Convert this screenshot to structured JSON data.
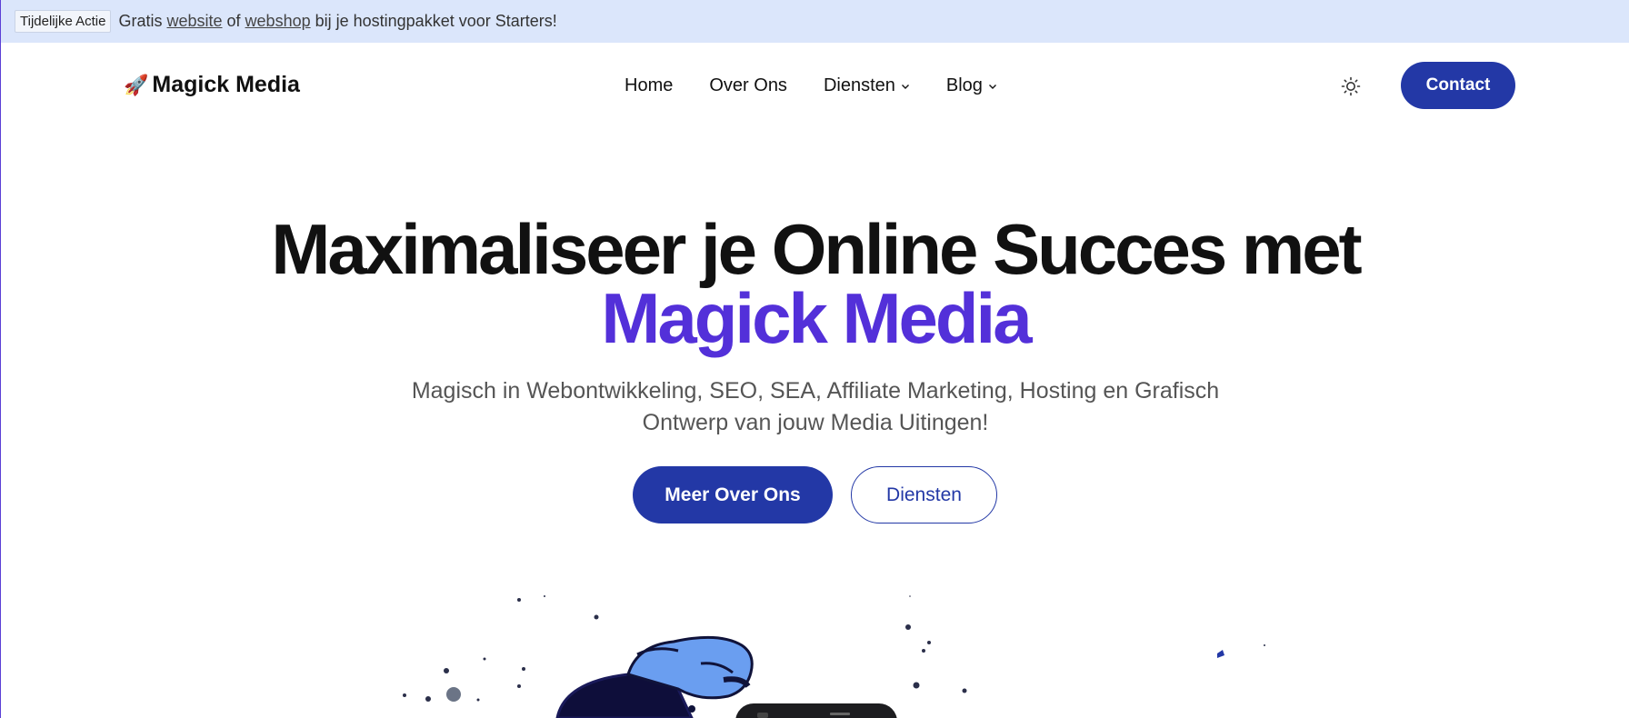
{
  "promo": {
    "badge": "Tijdelijke Actie",
    "text_before": "Gratis",
    "link_website": "website",
    "text_mid": "of",
    "link_webshop": "webshop",
    "text_after": "bij je hostingpakket voor Starters!"
  },
  "header": {
    "logo_icon": "rocket-icon",
    "logo_text": "Magick Media",
    "nav": {
      "home": "Home",
      "over_ons": "Over Ons",
      "diensten": "Diensten",
      "blog": "Blog"
    },
    "theme_icon": "sun-icon",
    "contact": "Contact"
  },
  "hero": {
    "title_line1": "Maximaliseer je Online Succes met",
    "title_brand": "Magick Media",
    "subtitle": "Magisch in Webontwikkeling, SEO, SEA, Affiliate Marketing, Hosting en Grafisch Ontwerp van jouw Media Uitingen!",
    "primary_button": "Meer Over Ons",
    "secondary_button": "Diensten"
  },
  "colors": {
    "accent": "#5330d9",
    "button": "#2338a6",
    "promo_bg": "#dbe6fb"
  }
}
